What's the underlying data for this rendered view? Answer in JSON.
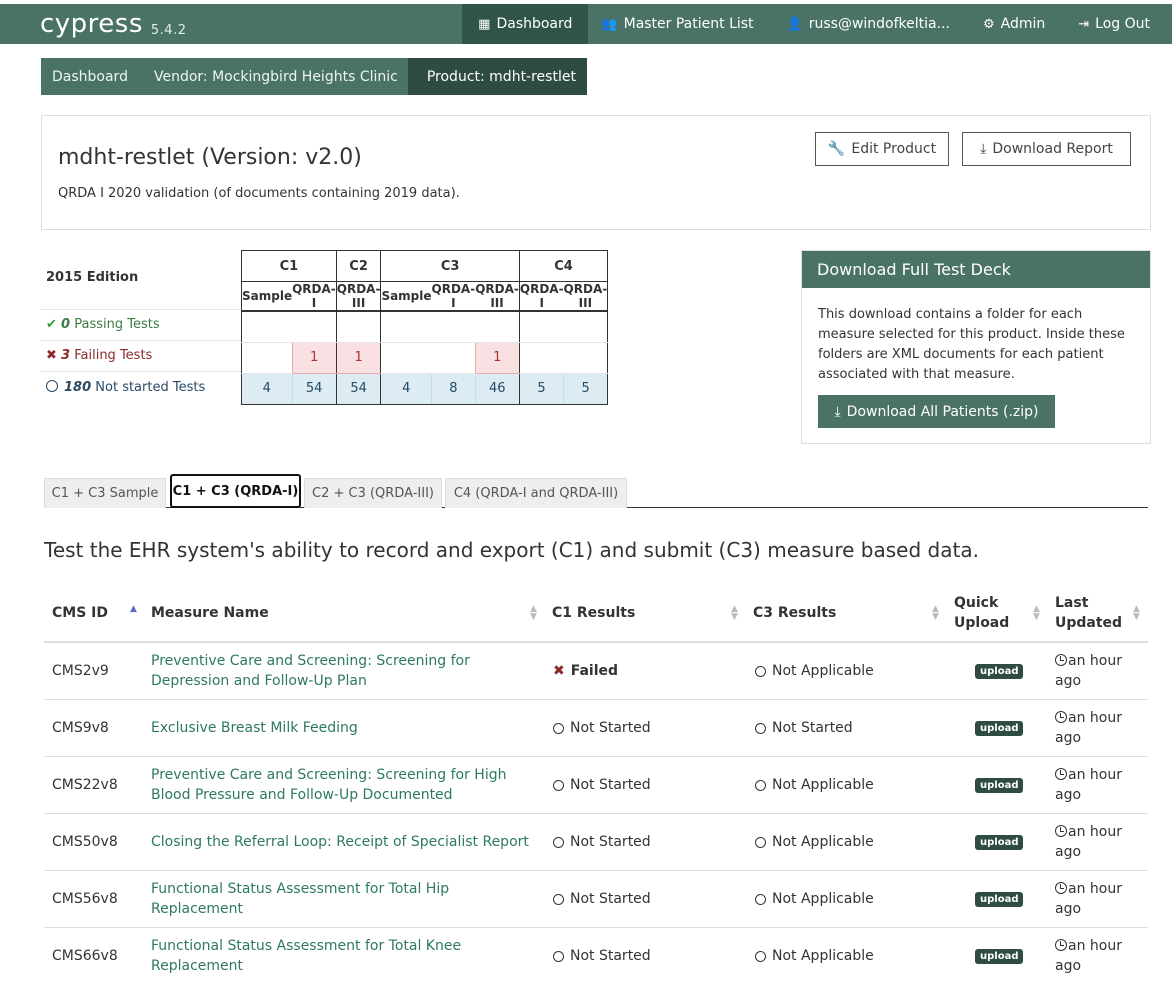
{
  "app": {
    "brand": "cypress",
    "version": "5.4.2"
  },
  "nav": {
    "dashboard": "Dashboard",
    "master_patient_list": "Master Patient List",
    "user": "russ@windofkeltia...",
    "admin": "Admin",
    "logout": "Log Out"
  },
  "breadcrumb": {
    "dashboard": "Dashboard",
    "vendor": "Vendor: Mockingbird Heights Clinic",
    "product": "Product: mdht-restlet"
  },
  "product": {
    "title": "mdht-restlet (Version: v2.0)",
    "description": "QRDA I 2020 validation (of documents containing 2019 data).",
    "edit_button": "Edit Product",
    "download_report_button": "Download Report"
  },
  "status": {
    "edition": "2015 Edition",
    "groups": [
      "C1",
      "C2",
      "C3",
      "C4"
    ],
    "subheaders": [
      "Sample",
      "QRDA-I",
      "QRDA-III",
      "Sample",
      "QRDA-I",
      "QRDA-III",
      "QRDA-I",
      "QRDA-III"
    ],
    "passing": {
      "count": "0",
      "label": "Passing Tests"
    },
    "failing": {
      "count": "3",
      "label": "Failing Tests",
      "values": [
        "",
        "1",
        "1",
        "",
        "",
        "1",
        "",
        ""
      ]
    },
    "not_started": {
      "count": "180",
      "label": "Not started Tests",
      "values": [
        "4",
        "54",
        "54",
        "4",
        "8",
        "46",
        "5",
        "5"
      ]
    }
  },
  "download_deck": {
    "title": "Download Full Test Deck",
    "body": "This download contains a folder for each measure selected for this product. Inside these folders are XML documents for each patient associated with that measure.",
    "button": "Download All Patients (.zip)"
  },
  "tabs": [
    {
      "label": "C1 + C3 Sample"
    },
    {
      "label": "C1 + C3 (QRDA-I)",
      "active": true
    },
    {
      "label": "C2 + C3 (QRDA-III)"
    },
    {
      "label": "C4 (QRDA-I and QRDA-III)"
    }
  ],
  "section_description": "Test the EHR system's ability to record and export (C1) and submit (C3) measure based data.",
  "measures": {
    "headers": {
      "cms_id": "CMS ID",
      "measure_name": "Measure Name",
      "c1_results": "C1 Results",
      "c3_results": "C3 Results",
      "quick_upload": "Quick Upload",
      "last_updated": "Last Updated"
    },
    "upload_label": "upload",
    "rows": [
      {
        "cms": "CMS2v9",
        "name": "Preventive Care and Screening: Screening for Depression and Follow-Up Plan",
        "c1": "Failed",
        "c3": "Not Applicable",
        "updated": "an hour ago"
      },
      {
        "cms": "CMS9v8",
        "name": "Exclusive Breast Milk Feeding",
        "c1": "Not Started",
        "c3": "Not Started",
        "updated": "an hour ago"
      },
      {
        "cms": "CMS22v8",
        "name": "Preventive Care and Screening: Screening for High Blood Pressure and Follow-Up Documented",
        "c1": "Not Started",
        "c3": "Not Applicable",
        "updated": "an hour ago"
      },
      {
        "cms": "CMS50v8",
        "name": "Closing the Referral Loop: Receipt of Specialist Report",
        "c1": "Not Started",
        "c3": "Not Applicable",
        "updated": "an hour ago"
      },
      {
        "cms": "CMS56v8",
        "name": "Functional Status Assessment for Total Hip Replacement",
        "c1": "Not Started",
        "c3": "Not Applicable",
        "updated": "an hour ago"
      },
      {
        "cms": "CMS66v8",
        "name": "Functional Status Assessment for Total Knee Replacement",
        "c1": "Not Started",
        "c3": "Not Applicable",
        "updated": "an hour ago"
      }
    ]
  }
}
